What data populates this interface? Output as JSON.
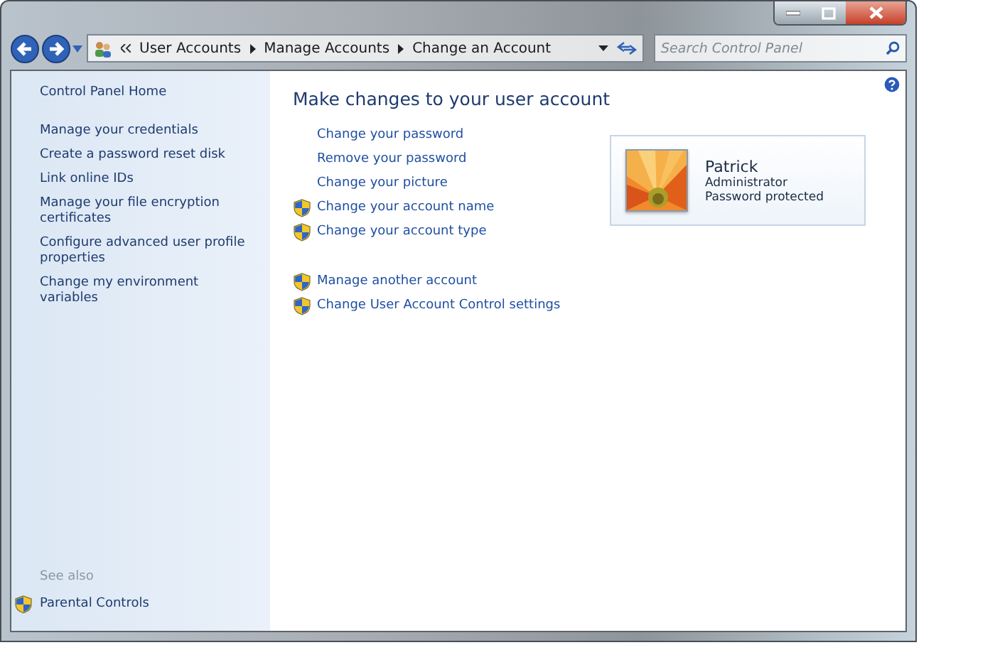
{
  "address_bar": {
    "breadcrumbs": [
      "User Accounts",
      "Manage Accounts",
      "Change an Account"
    ]
  },
  "search": {
    "placeholder": "Search Control Panel"
  },
  "sidebar": {
    "home": "Control Panel Home",
    "items": [
      {
        "label": "Manage your credentials"
      },
      {
        "label": "Create a password reset disk"
      },
      {
        "label": "Link online IDs"
      },
      {
        "label": "Manage your file encryption certificates"
      },
      {
        "label": "Configure advanced user profile properties"
      },
      {
        "label": "Change my environment variables"
      }
    ],
    "see_also": {
      "heading": "See also",
      "items": [
        {
          "label": "Parental Controls",
          "kind": "shield"
        }
      ]
    }
  },
  "main": {
    "title": "Make changes to your user account",
    "groups": [
      [
        {
          "label": "Change your password",
          "kind": "plain"
        },
        {
          "label": "Remove your password",
          "kind": "plain"
        },
        {
          "label": "Change your picture",
          "kind": "plain"
        },
        {
          "label": "Change your account name",
          "kind": "shield"
        },
        {
          "label": "Change your account type",
          "kind": "shield"
        }
      ],
      [
        {
          "label": "Manage another account",
          "kind": "shield"
        },
        {
          "label": "Change User Account Control settings",
          "kind": "shield"
        }
      ]
    ]
  },
  "account": {
    "name": "Patrick",
    "role": "Administrator",
    "status": "Password protected"
  }
}
